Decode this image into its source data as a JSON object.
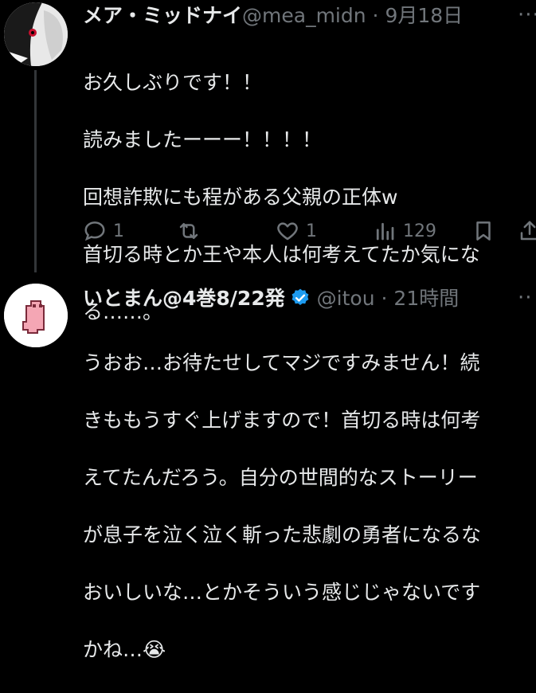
{
  "tweet1": {
    "display_name": "メア・ミッドナイ",
    "handle": "@mea_midn",
    "separator": "·",
    "date": "9月18日",
    "more": "···",
    "lines": [
      "お久しぶりです！！",
      "読みましたーーー！！！！",
      "回想詐欺にも程がある父親の正体w",
      "首切る時とか王や本人は何考えてたか気にな",
      "る……。"
    ],
    "actions": {
      "reply_count": "1",
      "retweet_count": "",
      "like_count": "1",
      "views_count": "129"
    }
  },
  "tweet2": {
    "display_name": "いとまん@4巻8/22発",
    "handle": "@itou",
    "separator": "·",
    "time": "21時間",
    "more": "··",
    "lines": [
      "うおお…お待たせしてマジですみません！続",
      "きももうすぐ上げますので！首切る時は何考",
      "えてたんだろう。自分の世間的なストーリー",
      "が息子を泣く泣く斬った悲劇の勇者になるな",
      "おいしいな…とかそういう感じじゃないです",
      "かね…😭"
    ]
  },
  "colors": {
    "background": "#000000",
    "text": "#e7e9ea",
    "muted": "#71767b",
    "verified": "#1d9bf0"
  }
}
